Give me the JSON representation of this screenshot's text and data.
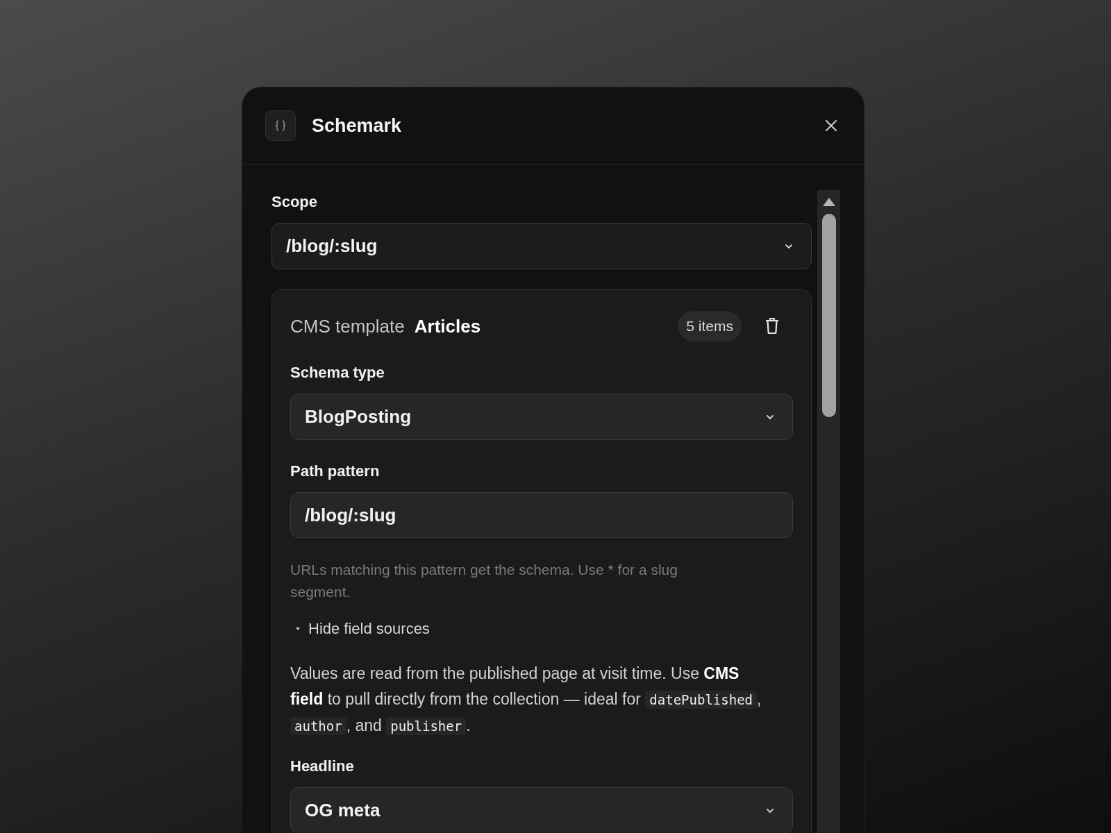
{
  "window": {
    "title": "Schemark"
  },
  "scope": {
    "label": "Scope",
    "value": "/blog/:slug"
  },
  "template": {
    "prefix": "CMS template",
    "name": "Articles",
    "count": "5 items",
    "schema_type": {
      "label": "Schema type",
      "value": "BlogPosting"
    },
    "path_pattern": {
      "label": "Path pattern",
      "value": "/blog/:slug",
      "hint": "URLs matching this pattern get the schema. Use * for a slug segment."
    },
    "field_sources": {
      "toggle": "Hide field sources",
      "expanded": true,
      "description": [
        {
          "kind": "text",
          "text": "Values are read from the published page at visit time. Use "
        },
        {
          "kind": "bold",
          "text": "CMS field"
        },
        {
          "kind": "text",
          "text": " to pull directly from the collection — ideal for "
        },
        {
          "kind": "code",
          "text": "datePublished"
        },
        {
          "kind": "text",
          "text": ", "
        },
        {
          "kind": "code",
          "text": "author"
        },
        {
          "kind": "text",
          "text": ", and "
        },
        {
          "kind": "code",
          "text": "publisher"
        },
        {
          "kind": "text",
          "text": "."
        }
      ]
    },
    "headline": {
      "label": "Headline",
      "value": "OG meta"
    }
  }
}
